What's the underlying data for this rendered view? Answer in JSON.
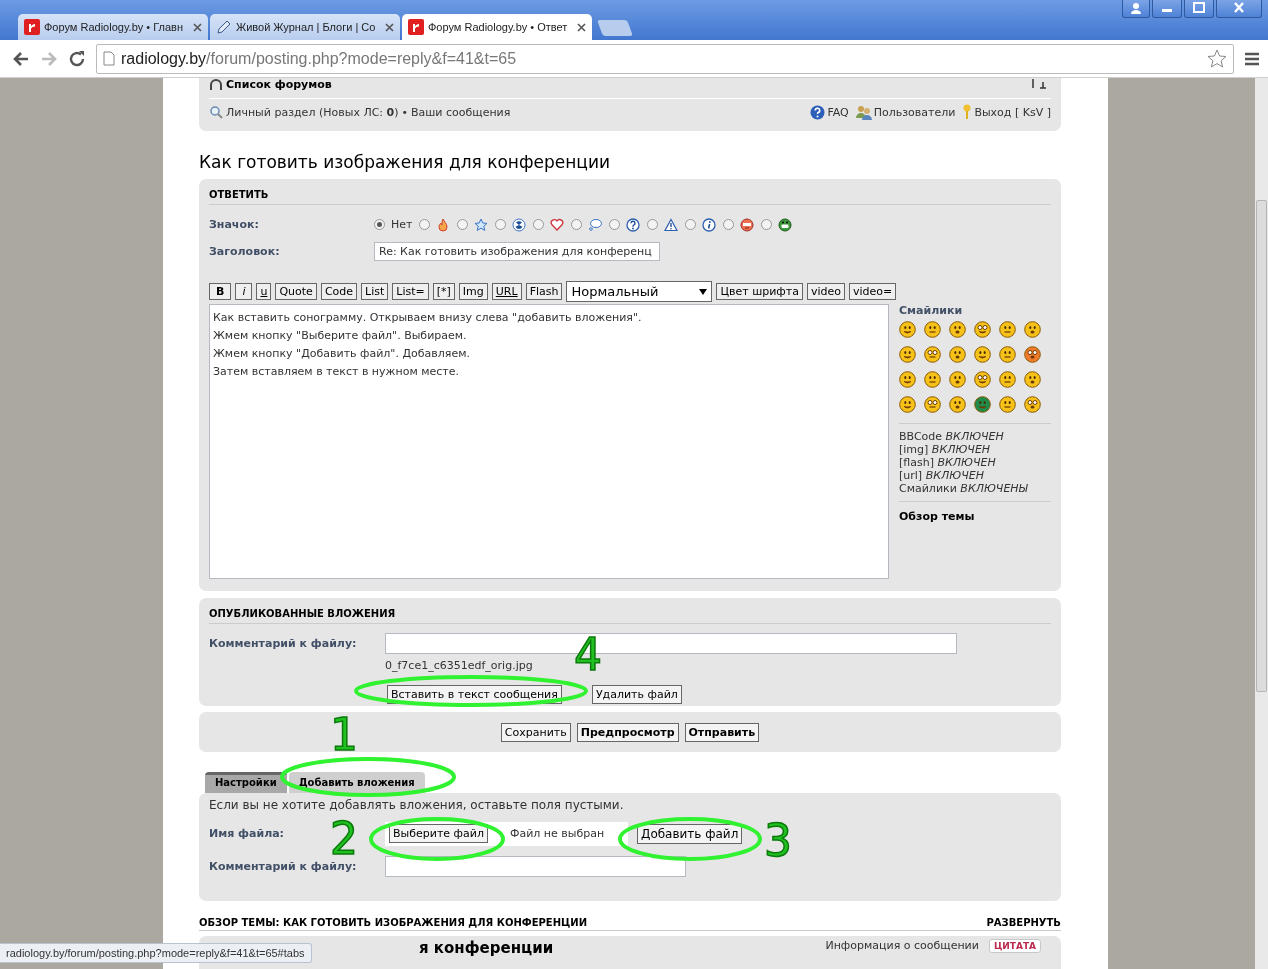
{
  "browser": {
    "tabs": [
      {
        "title": "Форум Radiology.by • Главн",
        "selected": false,
        "kind": "logo"
      },
      {
        "title": "Живой Журнал | Блоги | Со",
        "selected": false,
        "kind": "pencil"
      },
      {
        "title": "Форум Radiology.by • Ответ",
        "selected": true,
        "kind": "logo"
      }
    ],
    "url_host": "radiology.by",
    "url_path": "/forum/posting.php?mode=reply&f=41&t=65",
    "status_url": "radiology.by/forum/posting.php?mode=reply&f=41&t=65#tabs"
  },
  "nav": {
    "forum_list": "Список форумов",
    "personal": "Личный раздел (Новых ЛС: **0**)",
    "separator": "•",
    "messages": "Ваши сообщения",
    "links": [
      {
        "kind": "faq",
        "label": "FAQ"
      },
      {
        "kind": "users",
        "label": "Пользователи"
      },
      {
        "kind": "logout",
        "label": "Выход [ KsV ]"
      }
    ]
  },
  "topic_title": "Как готовить изображения для конференции",
  "reply": {
    "header": "ОТВЕТИТЬ",
    "icon_label": "Значок:",
    "icons": [
      {
        "label": "Нет",
        "selected": true
      },
      {
        "selected": false
      },
      {
        "selected": false
      },
      {
        "selected": false
      },
      {
        "selected": false
      },
      {
        "selected": false
      },
      {
        "selected": false
      },
      {
        "selected": false
      },
      {
        "selected": false
      },
      {
        "selected": false
      },
      {
        "selected": false
      }
    ],
    "subject_label": "Заголовок:",
    "subject": "Re: Как готовить изображения для конференц",
    "toolbar": [
      {
        "label": "B",
        "kind": "bold"
      },
      {
        "label": "i",
        "kind": "italic"
      },
      {
        "label": "u",
        "kind": "underline"
      },
      {
        "label": "Quote",
        "kind": "plain"
      },
      {
        "label": "Code",
        "kind": "plain"
      },
      {
        "label": "List",
        "kind": "plain"
      },
      {
        "label": "List=",
        "kind": "plain"
      },
      {
        "label": "[*]",
        "kind": "plain"
      },
      {
        "label": "Img",
        "kind": "plain"
      },
      {
        "label": "URL",
        "kind": "underline"
      },
      {
        "label": "Flash",
        "kind": "plain"
      }
    ],
    "font_size": "Нормальный",
    "toolbar_after": [
      "Цвет шрифта",
      "video",
      "video="
    ],
    "message": "Как вставить сонограмму. Открываем внизу слева \"добавить вложения\".\nЖмем кнопку \"Выберите файл\". Выбираем.\nЖмем кнопку \"Добавить файл\". Добавляем.\nЗатем вставляем в текст в нужном месте."
  },
  "sidebar": {
    "smilies_title": "Смайлики",
    "settings": [
      {
        "name": "BBCode",
        "value": "ВКЛЮЧЕН"
      },
      {
        "name": "[img]",
        "value": "ВКЛЮЧЕН"
      },
      {
        "name": "[flash]",
        "value": "ВКЛЮЧЕН"
      },
      {
        "name": "[url]",
        "value": "ВКЛЮЧЕН"
      },
      {
        "name": "Смайлики",
        "value": "ВКЛЮЧЕНЫ"
      }
    ],
    "topic_review": "Обзор темы"
  },
  "attachments": {
    "header": "ОПУБЛИКОВАННЫЕ ВЛОЖЕНИЯ",
    "comment_label": "Комментарий к файлу:",
    "filename": "0_f7ce1_c6351edf_orig.jpg",
    "buttons": [
      "Вставить в текст сообщения",
      "Удалить файл"
    ]
  },
  "submit": [
    {
      "label": "Сохранить",
      "primary": false
    },
    {
      "label": "Предпросмотр",
      "primary": true
    },
    {
      "label": "Отправить",
      "primary": true
    }
  ],
  "form_tabs": [
    {
      "label": "Настройки",
      "selected": false
    },
    {
      "label": "Добавить вложения",
      "selected": true
    }
  ],
  "attach_form": {
    "hint": "Если вы не хотите добавлять вложения, оставьте поля пустыми.",
    "file_label": "Имя файла:",
    "choose_button": "Выберите файл",
    "no_file": "Файл не выбран",
    "add_button": "Добавить файл",
    "comment_label": "Комментарий к файлу:"
  },
  "review": {
    "title": "ОБЗОР ТЕМЫ: КАК ГОТОВИТЬ ИЗОБРАЖЕНИЯ ДЛЯ КОНФЕРЕНЦИИ",
    "expand": "РАЗВЕРНУТЬ",
    "post_title": "я конференции",
    "post_info": "Информация о сообщении",
    "quote_button": "ЦИТАТА"
  },
  "annotations": [
    {
      "label": "4"
    },
    {
      "label": "1"
    },
    {
      "label": "2"
    },
    {
      "label": "3"
    }
  ]
}
